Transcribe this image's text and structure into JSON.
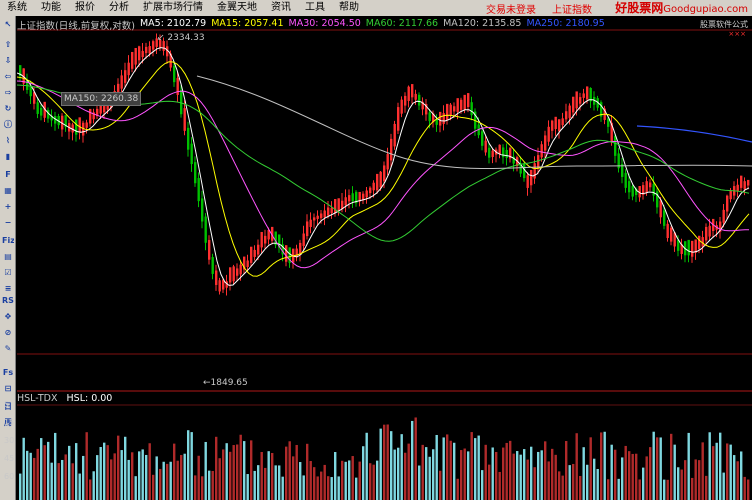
{
  "menu": {
    "items": [
      "系统",
      "功能",
      "报价",
      "分析",
      "扩展市场行情",
      "金翼天地",
      "资讯",
      "工具",
      "帮助"
    ],
    "login_status": "交易未登录",
    "index_link": "上证指数",
    "brand": "好股票网",
    "brand_domain": "Goodgupiao.com",
    "brand_sub": "股票软件公式"
  },
  "toolbar_icons": [
    "cursor-icon",
    "up-arrow-icon",
    "down-arrow-icon",
    "left-arrow-icon",
    "right-arrow-icon",
    "refresh-icon",
    "info-icon",
    "line-chart-icon",
    "bar-chart-icon",
    "f10-icon",
    "table-icon",
    "zoom-in-icon",
    "zoom-out-icon",
    "fiz-icon",
    "grid-icon",
    "calc-icon",
    "list-icon",
    "rsi-icon",
    "move-icon",
    "stop-icon",
    "pen-icon",
    "fs-icon",
    "kline-icon",
    "day-icon",
    "week-icon"
  ],
  "toolbar_labels": [
    "↖",
    "⇧",
    "⇩",
    "⇦",
    "⇨",
    "↻",
    "ⓘ",
    "⌇",
    "▮",
    "F",
    "▦",
    "+",
    "−",
    "Fiz",
    "▤",
    "☑",
    "≡",
    "RSI",
    "✥",
    "⊘",
    "✎",
    "Fs",
    "⊟",
    "日",
    "周"
  ],
  "chart": {
    "title": "上证指数(日线,前复权,对数)",
    "ma5": "MA5: 2102.79",
    "ma15": "MA15: 2057.41",
    "ma30": "MA30: 2054.50",
    "ma60": "MA60: 2117.66",
    "ma120": "MA120: 2135.85",
    "ma250": "MA250: 2180.95",
    "high_label": "2334.33",
    "low_label": "←1849.65",
    "ma_tag": "MA150: 2260.38",
    "right_note": "×××",
    "colors": {
      "up": "#ff3030",
      "down": "#00c000",
      "ma5": "#ffffff",
      "ma15": "#ffff00",
      "ma30": "#ff55ff",
      "ma60": "#33cc33",
      "ma120": "#c0c0c0",
      "ma250": "#3355ff",
      "vol_up": "#b02a2a",
      "vol_down": "#7fd8e0"
    }
  },
  "volume": {
    "indicator": "HSL-TDX",
    "value": "HSL: 0.00",
    "ticks": [
      "5",
      "15",
      "30",
      "45",
      "60"
    ]
  }
}
